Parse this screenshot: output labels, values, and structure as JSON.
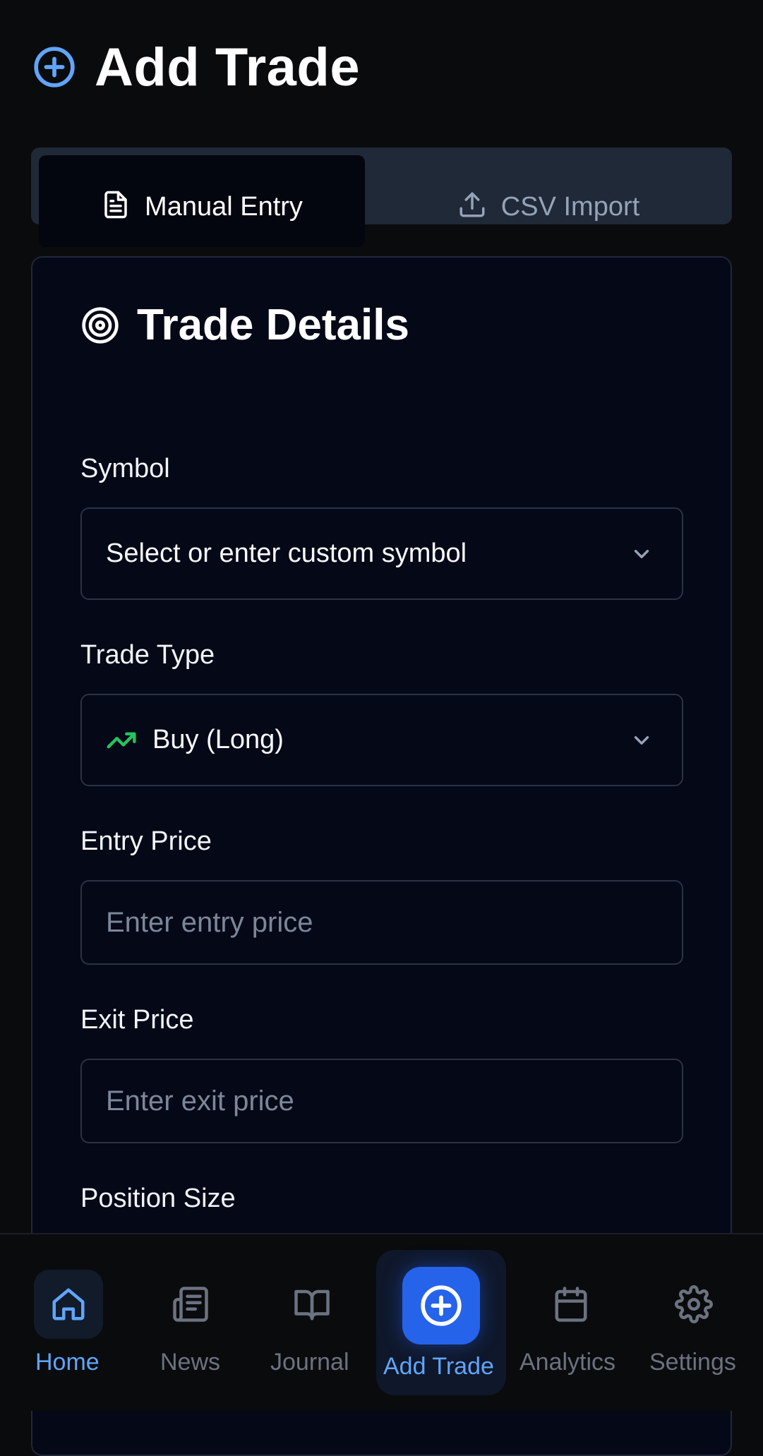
{
  "page": {
    "title": "Add Trade",
    "header_icon": "plus-circle-icon"
  },
  "tabs": [
    {
      "label": "Manual Entry",
      "icon": "document-icon",
      "active": true
    },
    {
      "label": "CSV Import",
      "icon": "upload-icon",
      "active": false
    }
  ],
  "card": {
    "title": "Trade Details",
    "icon": "target-icon"
  },
  "form": {
    "symbol": {
      "label": "Symbol",
      "value": "Select or enter custom symbol",
      "icon": "chevron-down-icon"
    },
    "trade_type": {
      "label": "Trade Type",
      "value": "Buy (Long)",
      "icon": "trending-up-icon",
      "icon_color": "#22c55e"
    },
    "entry_price": {
      "label": "Entry Price",
      "placeholder": "Enter entry price",
      "value": ""
    },
    "exit_price": {
      "label": "Exit Price",
      "placeholder": "Enter exit price",
      "value": ""
    },
    "position_size": {
      "label": "Position Size"
    }
  },
  "nav": {
    "items": [
      {
        "label": "Home",
        "icon": "home-icon",
        "active": true
      },
      {
        "label": "News",
        "icon": "newspaper-icon",
        "active": false
      },
      {
        "label": "Journal",
        "icon": "book-open-icon",
        "active": false
      },
      {
        "label": "Add Trade",
        "icon": "plus-circle-icon",
        "active": false
      },
      {
        "label": "Analytics",
        "icon": "calendar-icon",
        "active": false
      },
      {
        "label": "Settings",
        "icon": "gear-icon",
        "active": false
      }
    ]
  },
  "colors": {
    "background": "#0a0b0d",
    "card": "#050816",
    "accent": "#60a5fa",
    "accent_strong": "#2563eb",
    "muted": "#6b7280",
    "success": "#22c55e"
  }
}
